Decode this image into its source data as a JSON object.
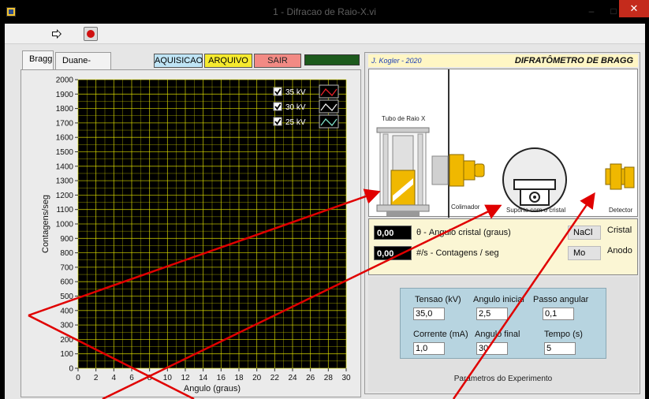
{
  "window": {
    "title": "1 - Difracao de Raio-X.vi",
    "minimize": "–",
    "maximize": "□",
    "close": "✕"
  },
  "tabs": [
    {
      "label": "Bragg",
      "active": true
    },
    {
      "label": "Duane-Hunt",
      "active": false
    }
  ],
  "buttons": {
    "aquisicao": "AQUISICAO",
    "arquivo": "ARQUIVO",
    "sair": "SAIR"
  },
  "chart_data": {
    "type": "line",
    "xlabel": "Angulo (graus)",
    "ylabel": "Contagens/seg",
    "xlim": [
      0,
      30
    ],
    "ylim": [
      0,
      2000
    ],
    "x_ticks": [
      0,
      2,
      4,
      6,
      8,
      10,
      12,
      14,
      16,
      18,
      20,
      22,
      24,
      26,
      28,
      30
    ],
    "y_ticks": [
      0,
      100,
      200,
      300,
      400,
      500,
      600,
      700,
      800,
      900,
      1000,
      1100,
      1200,
      1300,
      1400,
      1500,
      1600,
      1700,
      1800,
      1900,
      2000
    ],
    "grid": true,
    "legend_position": "top-right",
    "series": [
      {
        "name": "35 kV",
        "color": "#e8202a",
        "visible": true,
        "values": []
      },
      {
        "name": "30 kV",
        "color": "#f0f0f0",
        "visible": true,
        "values": []
      },
      {
        "name": "25 kV",
        "color": "#7fe0c8",
        "visible": true,
        "values": []
      }
    ],
    "plot_background": "#000000",
    "grid_color": "#e6e600"
  },
  "header": {
    "author": "J. Kogler - 2020",
    "title": "DIFRATÔMETRO DE BRAGG"
  },
  "apparatus": {
    "tube_label": "Tubo de Raio X",
    "collimator_label": "Colimador",
    "holder_label": "Suporte com o cristal",
    "detector_label": "Detector"
  },
  "readouts": {
    "angle_value": "0,00",
    "angle_label": "θ  -  Angulo cristal (graus)",
    "counts_value": "0,00",
    "counts_label": "#/s  -  Contagens / seg",
    "crystal_value": "NaCl",
    "crystal_label": "Cristal",
    "anode_value": "Mo",
    "anode_label": "Anodo"
  },
  "params": {
    "tensao_label": "Tensao (kV)",
    "tensao_value": "35,0",
    "ang_ini_label": "Angulo inicial",
    "ang_ini_value": "2,5",
    "passo_label": "Passo angular",
    "passo_value": "0,1",
    "corrente_label": "Corrente (mA)",
    "corrente_value": "1,0",
    "ang_fin_label": "Angulo final",
    "ang_fin_value": "30",
    "tempo_label": "Tempo (s)",
    "tempo_value": "5",
    "caption": "Parametros do Experimento"
  }
}
